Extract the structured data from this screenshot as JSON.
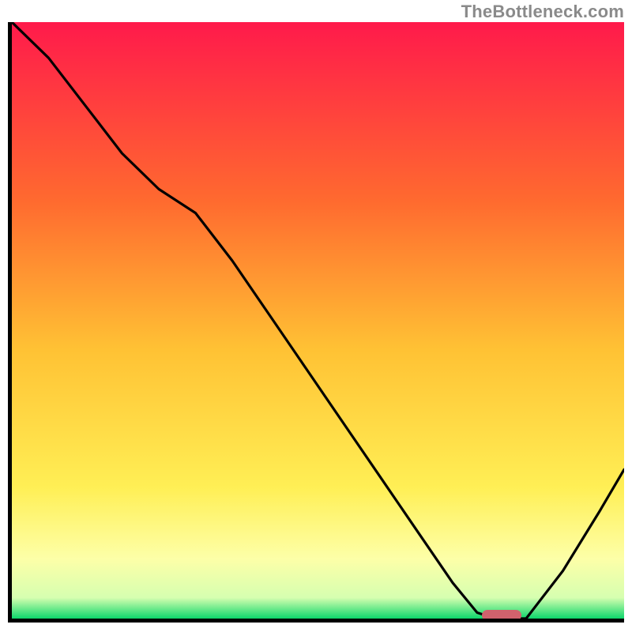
{
  "watermark": "TheBottleneck.com",
  "colors": {
    "gradient_top": "#ff1a4b",
    "gradient_mid1": "#ff8a2b",
    "gradient_mid2": "#ffe23a",
    "gradient_pale": "#ffffb0",
    "gradient_bottom": "#0dd66b",
    "curve": "#000000",
    "marker": "#d1626d",
    "axis": "#000000"
  },
  "chart_data": {
    "type": "line",
    "title": "",
    "xlabel": "",
    "ylabel": "",
    "xlim": [
      0,
      100
    ],
    "ylim": [
      0,
      100
    ],
    "x": [
      0,
      6,
      12,
      18,
      24,
      30,
      36,
      42,
      48,
      54,
      60,
      66,
      72,
      76,
      79,
      84,
      90,
      96,
      100
    ],
    "values": [
      100,
      94,
      86,
      78,
      72,
      68,
      60,
      51,
      42,
      33,
      24,
      15,
      6,
      1,
      0,
      0,
      8,
      18,
      25
    ],
    "marker_min": {
      "x": 80,
      "y": 0.5
    },
    "background_gradient_stops": [
      {
        "offset": 0.0,
        "color": "#ff1a4b"
      },
      {
        "offset": 0.3,
        "color": "#ff6a2f"
      },
      {
        "offset": 0.55,
        "color": "#ffc234"
      },
      {
        "offset": 0.78,
        "color": "#ffef55"
      },
      {
        "offset": 0.9,
        "color": "#fdffa8"
      },
      {
        "offset": 0.965,
        "color": "#d6ffb0"
      },
      {
        "offset": 1.0,
        "color": "#0dd66b"
      }
    ]
  }
}
